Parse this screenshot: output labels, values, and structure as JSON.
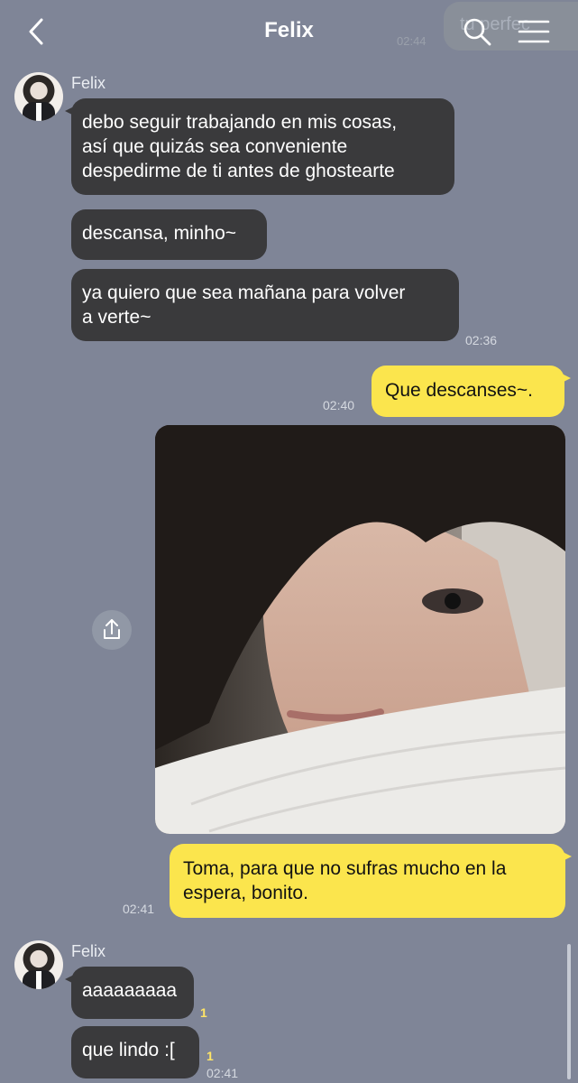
{
  "header": {
    "title": "Felix",
    "ghost_text": "tu perfec",
    "ghost_time": "02:44"
  },
  "messages": {
    "felix_name_1": "Felix",
    "m1": "debo seguir trabajando en mis cosas,\nasí que quizás sea conveniente\ndespedirme de ti antes de ghostearte",
    "m2": "descansa, minho~",
    "m3": "ya quiero que sea mañana para volver\na verte~",
    "m3_time": "02:36",
    "o1": "Que descanses~.",
    "o1_time": "02:40",
    "o2": "Toma, para que no sufras mucho en la\nespera, bonito.",
    "o2_time": "02:41",
    "felix_name_2": "Felix",
    "m4": "aaaaaaaaa",
    "m4_unread": "1",
    "m5": "que lindo :[",
    "m5_unread": "1",
    "m5_time": "02:41"
  },
  "icons": {
    "back": "chevron-left-icon",
    "search": "search-icon",
    "menu": "hamburger-menu-icon",
    "share": "share-upload-icon"
  },
  "colors": {
    "background": "#7f8597",
    "incoming_bubble": "#3a3a3c",
    "outgoing_bubble": "#fbe54d",
    "unread_count": "#ffe566"
  }
}
